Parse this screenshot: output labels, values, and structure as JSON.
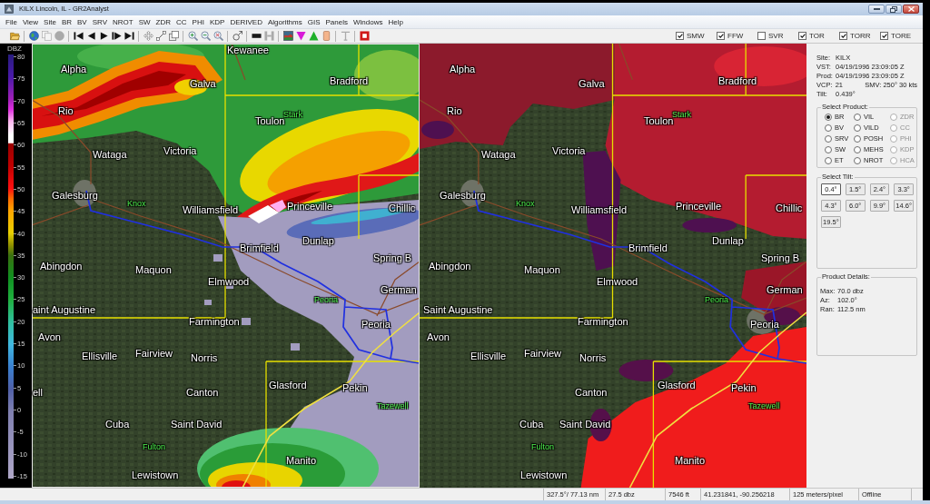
{
  "window": {
    "title": "KILX Lincoln, IL - GR2Analyst"
  },
  "menu": [
    "File",
    "View",
    "Site",
    "BR",
    "BV",
    "SRV",
    "NROT",
    "SW",
    "ZDR",
    "CC",
    "PHI",
    "KDP",
    "DERIVED",
    "Algorithms",
    "GIS",
    "Panels",
    "Windows",
    "Help"
  ],
  "toolbar": [
    [
      {
        "kind": "open",
        "disabled": false
      }
    ],
    [
      {
        "kind": "globe",
        "disabled": false
      },
      {
        "kind": "pages",
        "disabled": true
      },
      {
        "kind": "globe",
        "disabled": true
      }
    ],
    [
      {
        "kind": "first",
        "disabled": false
      },
      {
        "kind": "prev",
        "disabled": false
      },
      {
        "kind": "play",
        "disabled": false
      },
      {
        "kind": "next",
        "disabled": false
      },
      {
        "kind": "last",
        "disabled": false
      }
    ],
    [
      {
        "kind": "pan",
        "disabled": false
      },
      {
        "kind": "resize",
        "disabled": false
      },
      {
        "kind": "layers",
        "disabled": false
      }
    ],
    [
      {
        "kind": "zoom_in",
        "disabled": false
      },
      {
        "kind": "zoom_out",
        "disabled": false
      },
      {
        "kind": "zoom_clear",
        "disabled": false
      }
    ],
    [
      {
        "kind": "probe",
        "disabled": false
      }
    ],
    [
      {
        "kind": "bar",
        "disabled": false
      },
      {
        "kind": "columns",
        "disabled": true
      }
    ],
    [
      {
        "kind": "colormap",
        "disabled": false
      },
      {
        "kind": "triangle_down",
        "disabled": false
      },
      {
        "kind": "triangle_up",
        "disabled": false
      },
      {
        "kind": "swatch",
        "disabled": false
      }
    ],
    [
      {
        "kind": "text",
        "disabled": true
      }
    ],
    [
      {
        "kind": "stop",
        "disabled": false
      }
    ]
  ],
  "warning_filters": [
    {
      "label": "SMW",
      "checked": true
    },
    {
      "label": "FFW",
      "checked": true
    },
    {
      "label": "SVR",
      "checked": false
    },
    {
      "label": "TOR",
      "checked": true
    },
    {
      "label": "TORR",
      "checked": true
    },
    {
      "label": "TORE",
      "checked": true
    }
  ],
  "color_scale": {
    "title": "DBZ",
    "ticks": [
      "80",
      "75",
      "70",
      "65",
      "60",
      "55",
      "50",
      "45",
      "40",
      "35",
      "30",
      "25",
      "20",
      "15",
      "10",
      "5",
      "0",
      "-5",
      "-10",
      "-15"
    ]
  },
  "map_panels": [
    {
      "kind": "reflectivity",
      "selected": true,
      "labels": [
        {
          "text": "Kewanee",
          "kind": "town"
        },
        {
          "text": "Alpha",
          "kind": "town"
        },
        {
          "text": "Galva",
          "kind": "town"
        },
        {
          "text": "Bradford",
          "kind": "town"
        },
        {
          "text": "Rio",
          "kind": "town"
        },
        {
          "text": "Toulon",
          "kind": "town"
        },
        {
          "text": "Stark",
          "kind": "county"
        },
        {
          "text": "Wataga",
          "kind": "town"
        },
        {
          "text": "Victoria",
          "kind": "town"
        },
        {
          "text": "Galesburg",
          "kind": "town"
        },
        {
          "text": "Knox",
          "kind": "county"
        },
        {
          "text": "Williamsfield",
          "kind": "town"
        },
        {
          "text": "Princeville",
          "kind": "town"
        },
        {
          "text": "Chillic",
          "kind": "town"
        },
        {
          "text": "Dunlap",
          "kind": "town"
        },
        {
          "text": "Brimfield",
          "kind": "town"
        },
        {
          "text": "Spring B",
          "kind": "town"
        },
        {
          "text": "Abingdon",
          "kind": "town"
        },
        {
          "text": "Maquon",
          "kind": "town"
        },
        {
          "text": "Elmwood",
          "kind": "town"
        },
        {
          "text": "German",
          "kind": "town"
        },
        {
          "text": "Peoria",
          "kind": "county"
        },
        {
          "text": "aint Augustine",
          "kind": "town"
        },
        {
          "text": "Farmington",
          "kind": "town"
        },
        {
          "text": "Peoria",
          "kind": "town"
        },
        {
          "text": "Avon",
          "kind": "town"
        },
        {
          "text": "Ellisville",
          "kind": "town"
        },
        {
          "text": "Fairview",
          "kind": "town"
        },
        {
          "text": "Norris",
          "kind": "town"
        },
        {
          "text": "ell",
          "kind": "town"
        },
        {
          "text": "Canton",
          "kind": "town"
        },
        {
          "text": "Glasford",
          "kind": "town"
        },
        {
          "text": "Pekin",
          "kind": "town"
        },
        {
          "text": "Tazewell",
          "kind": "county"
        },
        {
          "text": "Cuba",
          "kind": "town"
        },
        {
          "text": "Saint David",
          "kind": "town"
        },
        {
          "text": "Fulton",
          "kind": "county"
        },
        {
          "text": "Manito",
          "kind": "town"
        },
        {
          "text": "Lewistown",
          "kind": "town"
        }
      ]
    },
    {
      "kind": "velocity",
      "selected": false,
      "labels": [
        {
          "text": "Alpha",
          "kind": "town"
        },
        {
          "text": "Galva",
          "kind": "town"
        },
        {
          "text": "Bradford",
          "kind": "town"
        },
        {
          "text": "Rio",
          "kind": "town"
        },
        {
          "text": "Toulon",
          "kind": "town"
        },
        {
          "text": "Stark",
          "kind": "county"
        },
        {
          "text": "Wataga",
          "kind": "town"
        },
        {
          "text": "Victoria",
          "kind": "town"
        },
        {
          "text": "Galesburg",
          "kind": "town"
        },
        {
          "text": "Knox",
          "kind": "county"
        },
        {
          "text": "Williamsfield",
          "kind": "town"
        },
        {
          "text": "Princeville",
          "kind": "town"
        },
        {
          "text": "Chillic",
          "kind": "town"
        },
        {
          "text": "Dunlap",
          "kind": "town"
        },
        {
          "text": "Brimfield",
          "kind": "town"
        },
        {
          "text": "Spring B",
          "kind": "town"
        },
        {
          "text": "Abingdon",
          "kind": "town"
        },
        {
          "text": "Maquon",
          "kind": "town"
        },
        {
          "text": "Elmwood",
          "kind": "town"
        },
        {
          "text": "German",
          "kind": "town"
        },
        {
          "text": "Peoria",
          "kind": "county"
        },
        {
          "text": "Saint Augustine",
          "kind": "town"
        },
        {
          "text": "Farmington",
          "kind": "town"
        },
        {
          "text": "Peoria",
          "kind": "town"
        },
        {
          "text": "Avon",
          "kind": "town"
        },
        {
          "text": "Ellisville",
          "kind": "town"
        },
        {
          "text": "Fairview",
          "kind": "town"
        },
        {
          "text": "Norris",
          "kind": "town"
        },
        {
          "text": "Canton",
          "kind": "town"
        },
        {
          "text": "Glasford",
          "kind": "town"
        },
        {
          "text": "Pekin",
          "kind": "town"
        },
        {
          "text": "Tazewell",
          "kind": "county"
        },
        {
          "text": "Cuba",
          "kind": "town"
        },
        {
          "text": "Saint David",
          "kind": "town"
        },
        {
          "text": "Fulton",
          "kind": "county"
        },
        {
          "text": "Manito",
          "kind": "town"
        },
        {
          "text": "Lewistown",
          "kind": "town"
        }
      ]
    }
  ],
  "site_info": [
    {
      "label": "Site:",
      "value": "KILX"
    },
    {
      "label": "VST:",
      "value": "04/19/1996 23:09:05 Z"
    },
    {
      "label": "Prod:",
      "value": "04/19/1996 23:09:05 Z"
    },
    {
      "label": "VCP:",
      "value": "21",
      "extra": "SMV: 250° 30 kts"
    },
    {
      "label": "Tilt:",
      "value": "0.439°"
    }
  ],
  "select_product": {
    "title": "Select Product:",
    "options": [
      {
        "label": "BR",
        "selected": true,
        "disabled": false
      },
      {
        "label": "VIL",
        "selected": false,
        "disabled": false
      },
      {
        "label": "ZDR",
        "selected": false,
        "disabled": true
      },
      {
        "label": "BV",
        "selected": false,
        "disabled": false
      },
      {
        "label": "VILD",
        "selected": false,
        "disabled": false
      },
      {
        "label": "CC",
        "selected": false,
        "disabled": true
      },
      {
        "label": "SRV",
        "selected": false,
        "disabled": false
      },
      {
        "label": "POSH",
        "selected": false,
        "disabled": false
      },
      {
        "label": "PHI",
        "selected": false,
        "disabled": true
      },
      {
        "label": "SW",
        "selected": false,
        "disabled": false
      },
      {
        "label": "MEHS",
        "selected": false,
        "disabled": false
      },
      {
        "label": "KDP",
        "selected": false,
        "disabled": true
      },
      {
        "label": "ET",
        "selected": false,
        "disabled": false
      },
      {
        "label": "NROT",
        "selected": false,
        "disabled": false
      },
      {
        "label": "HCA",
        "selected": false,
        "disabled": true
      }
    ]
  },
  "select_tilt": {
    "title": "Select Tilt:",
    "options": [
      {
        "label": "0.4°",
        "selected": true
      },
      {
        "label": "1.5°",
        "selected": false
      },
      {
        "label": "2.4°",
        "selected": false
      },
      {
        "label": "3.3°",
        "selected": false
      },
      {
        "label": "4.3°",
        "selected": false
      },
      {
        "label": "6.0°",
        "selected": false
      },
      {
        "label": "9.9°",
        "selected": false
      },
      {
        "label": "14.6°",
        "selected": false
      },
      {
        "label": "19.5°",
        "selected": false
      }
    ]
  },
  "product_details": {
    "title": "Product Details:",
    "lines": [
      {
        "label": "Max:",
        "value": "70.0 dbz"
      },
      {
        "label": "Az:",
        "value": "102.0°"
      },
      {
        "label": "Ran:",
        "value": "112.5 nm"
      }
    ]
  },
  "status_bar": [
    "327.5°/ 77.13 nm",
    "27.5 dbz",
    "7546 ft",
    "41.231841, -90.256218",
    "125 meters/pixel",
    "Offline"
  ]
}
